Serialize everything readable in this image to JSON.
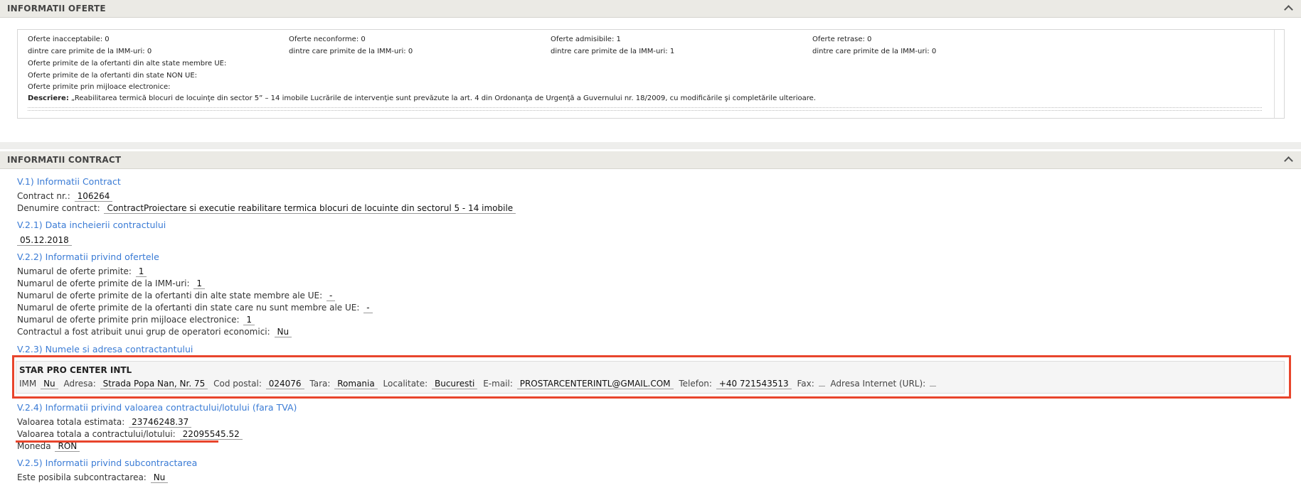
{
  "offers_panel": {
    "title": "INFORMATII OFERTE",
    "col1": [
      "Oferte inacceptabile: 0",
      "dintre care primite de la IMM-uri: 0"
    ],
    "col2": [
      "Oferte neconforme: 0",
      "dintre care primite de la IMM-uri: 0"
    ],
    "col3": [
      "Oferte admisibile: 1",
      "dintre care primite de la IMM-uri: 1"
    ],
    "col4": [
      "Oferte retrase: 0",
      "dintre care primite de la IMM-uri: 0"
    ],
    "lines": [
      "Oferte primite de la ofertanti din alte state membre UE:",
      "Oferte primite de la ofertanti din state NON UE:",
      "Oferte primite prin mijloace electronice:"
    ],
    "description_label": "Descriere:",
    "description_text": " „Reabilitarea termică blocuri de locuinţe din sector 5” – 14 imobile Lucrările de intervenţie sunt prevăzute la art. 4 din Ordonanţa de Urgenţă a Guvernului nr. 18/2009, cu modificările şi completările ulterioare."
  },
  "contract_panel": {
    "title": "INFORMATII CONTRACT",
    "s_v1": "V.1) Informatii Contract",
    "contract_nr_label": "Contract nr.:",
    "contract_nr": "106264",
    "denumire_label": "Denumire contract:",
    "denumire": "ContractProiectare si executie reabilitare termica blocuri de locuinte din sectorul 5 - 14 imobile",
    "s_v21": "V.2.1) Data incheierii contractului",
    "date": "05.12.2018",
    "s_v22": "V.2.2) Informatii privind ofertele",
    "offers": [
      {
        "label": "Numarul de oferte primite:",
        "value": "1"
      },
      {
        "label": "Numarul de oferte primite de la IMM-uri:",
        "value": "1"
      },
      {
        "label": "Numarul de oferte primite de la ofertanti din alte state membre ale UE:",
        "value": "-"
      },
      {
        "label": "Numarul de oferte primite de la ofertanti din state care nu sunt membre ale UE:",
        "value": "-"
      },
      {
        "label": "Numarul de oferte primite prin mijloace electronice:",
        "value": "1"
      },
      {
        "label": "Contractul a fost atribuit unui grup de operatori economici:",
        "value": "Nu"
      }
    ],
    "s_v23": "V.2.3) Numele si adresa contractantului",
    "contractor": {
      "name": "STAR PRO CENTER INTL",
      "imm_label": "IMM",
      "imm": "Nu",
      "adresa_label": "Adresa:",
      "adresa": "Strada Popa Nan, Nr. 75",
      "cod_label": "Cod postal:",
      "cod": "024076",
      "tara_label": "Tara:",
      "tara": "Romania",
      "loc_label": "Localitate:",
      "loc": "Bucuresti",
      "email_label": "E-mail:",
      "email": "PROSTARCENTERINTL@GMAIL.COM",
      "tel_label": "Telefon:",
      "tel": "+40 721543513",
      "fax_label": "Fax:",
      "fax": "",
      "url_label": "Adresa Internet (URL):",
      "url": ""
    },
    "s_v24": "V.2.4) Informatii privind valoarea contractului/lotului (fara TVA)",
    "estimata_label": "Valoarea totala estimata:",
    "estimata": "23746248.37",
    "totala_label": "Valoarea totala a contractului/lotului:",
    "totala": "22095545.52",
    "moneda_label": "Moneda",
    "moneda": "RON",
    "s_v25": "V.2.5) Informatii privind subcontractarea",
    "subcontract_label": "Este posibila subcontractarea:",
    "subcontract": "Nu"
  }
}
